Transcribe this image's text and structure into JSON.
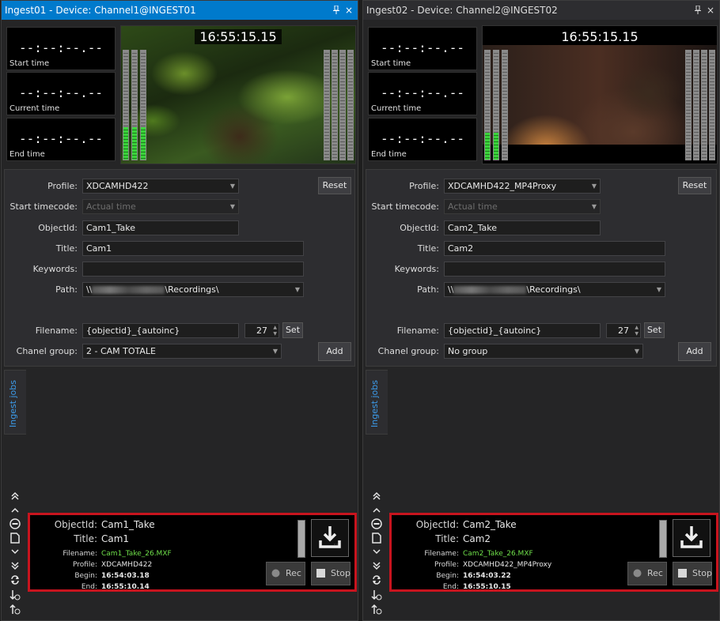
{
  "panels": [
    {
      "title": "Ingest01 - Device: Channel1@INGEST01",
      "pin_icon": "pin-icon",
      "close_glyph": "×",
      "start_time": "--:--:--.--",
      "start_label": "Start time",
      "current_time": "--:--:--.--",
      "current_label": "Current time",
      "end_time": "--:--:--.--",
      "end_label": "End time",
      "video_timecode": "16:55:15.15",
      "audio_levels_left": [
        0.3,
        0.3,
        0.3
      ],
      "audio_levels_right": [
        0,
        0,
        0,
        0
      ],
      "profile_label": "Profile:",
      "profile_value": "XDCAMHD422",
      "reset_label": "Reset",
      "start_timecode_label": "Start timecode:",
      "start_timecode_value": "Actual time",
      "objectid_label": "ObjectId:",
      "objectid_value": "Cam1_Take",
      "title_label": "Title:",
      "title_value": "Cam1",
      "keywords_label": "Keywords:",
      "keywords_value": "",
      "path_label": "Path:",
      "path_prefix": "\\\\",
      "path_suffix": "\\Recordings\\",
      "filename_label": "Filename:",
      "filename_value": "{objectid}_{autoinc}",
      "autoinc_value": "27",
      "set_label": "Set",
      "channel_group_label": "Chanel group:",
      "channel_group_value": "2 - CAM TOTALE",
      "add_label": "Add",
      "ingest_jobs_tab": "Ingest jobs",
      "job": {
        "objectid_key": "ObjectId:",
        "objectid": "Cam1_Take",
        "title_key": "Title:",
        "title": "Cam1",
        "filename_key": "Filename:",
        "filename": "Cam1_Take_26.MXF",
        "profile_key": "Profile:",
        "profile": "XDCAMHD422",
        "begin_key": "Begin:",
        "begin": "16:54:03.18",
        "end_key": "End:",
        "end": "16:55:10.14",
        "rec_label": "Rec",
        "stop_label": "Stop"
      }
    },
    {
      "title": "Ingest02 - Device: Channel2@INGEST02",
      "pin_icon": "pin-icon",
      "close_glyph": "×",
      "start_time": "--:--:--.--",
      "start_label": "Start time",
      "current_time": "--:--:--.--",
      "current_label": "Current time",
      "end_time": "--:--:--.--",
      "end_label": "End time",
      "video_timecode": "16:55:15.15",
      "audio_levels_left": [
        0.25,
        0.25,
        0
      ],
      "audio_levels_right": [
        0,
        0,
        0,
        0
      ],
      "profile_label": "Profile:",
      "profile_value": "XDCAMHD422_MP4Proxy",
      "reset_label": "Reset",
      "start_timecode_label": "Start timecode:",
      "start_timecode_value": "Actual time",
      "objectid_label": "ObjectId:",
      "objectid_value": "Cam2_Take",
      "title_label": "Title:",
      "title_value": "Cam2",
      "keywords_label": "Keywords:",
      "keywords_value": "",
      "path_label": "Path:",
      "path_prefix": "\\\\",
      "path_suffix": "\\Recordings\\",
      "filename_label": "Filename:",
      "filename_value": "{objectid}_{autoinc}",
      "autoinc_value": "27",
      "set_label": "Set",
      "channel_group_label": "Chanel group:",
      "channel_group_value": "No group",
      "add_label": "Add",
      "ingest_jobs_tab": "Ingest jobs",
      "job": {
        "objectid_key": "ObjectId:",
        "objectid": "Cam2_Take",
        "title_key": "Title:",
        "title": "Cam2",
        "filename_key": "Filename:",
        "filename": "Cam2_Take_26.MXF",
        "profile_key": "Profile:",
        "profile": "XDCAMHD422_MP4Proxy",
        "begin_key": "Begin:",
        "begin": "16:54:03.22",
        "end_key": "End:",
        "end": "16:55:10.15",
        "rec_label": "Rec",
        "stop_label": "Stop"
      }
    }
  ],
  "colors": {
    "accent": "#007acc",
    "job_border": "#c8141e",
    "filename_green": "#6fe04a",
    "tab_blue": "#3c9bea"
  },
  "sidebar_icons": [
    "scroll-top-icon",
    "scroll-up-icon",
    "minus-circle-icon",
    "document-icon",
    "scroll-down-icon",
    "scroll-bottom-icon",
    "refresh-icon",
    "sort-down-clock-icon",
    "sort-up-clock-icon"
  ]
}
